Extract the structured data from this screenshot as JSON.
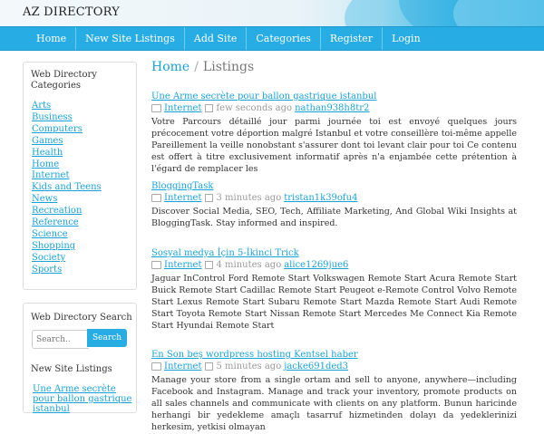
{
  "header": {
    "brand": "AZ DIRECTORY"
  },
  "nav": [
    "Home",
    "New Site Listings",
    "Add Site",
    "Categories",
    "Register",
    "Login"
  ],
  "sidebar": {
    "categories_title": "Web Directory Categories",
    "categories": [
      "Arts",
      "Business",
      "Computers",
      "Games",
      "Health",
      "Home",
      "Internet",
      "Kids and Teens",
      "News",
      "Recreation",
      "Reference",
      "Science",
      "Shopping",
      "Society",
      "Sports"
    ],
    "search_title": "Web Directory Search",
    "search_placeholder": "Search..",
    "search_button": "Search",
    "new_listings_title": "New Site Listings",
    "new_listing_link": "Une Arme secrète pour ballon gastrique istanbul"
  },
  "breadcrumb": {
    "home": "Home",
    "sep": "/",
    "current": "Listings"
  },
  "listings": [
    {
      "title": "Une Arme secrète pour ballon gastrique istanbul",
      "category": "Internet",
      "time": "few seconds ago",
      "user": "nathan938h8tr2",
      "description": "Votre Parcours détaillé jour parmi journée toi est envoyé quelques jours précocement votre déportion malgré Istanbul et votre conseillère toi-même appelle Pareillement la veille nonobstant s'assurer dont toi levant clair pour toi Ce contenu est offert à titre exclusivement informatif après n'a enjambée cette prétention à l'égard de remplacer les"
    },
    {
      "title": "BloggingTask",
      "category": "Internet",
      "time": "3 minutes ago",
      "user": "tristan1k39ofu4",
      "description": "Discover Social Media, SEO, Tech, Affiliate Marketing, And Global Wiki Insights at BloggingTask. Stay informed and inspired."
    },
    {
      "title": "Sosyal medya İçin 5-İkinci Trick",
      "category": "Internet",
      "time": "4 minutes ago",
      "user": "alice1269jue6",
      "description": "Jaguar InControl Ford Remote Start Volkswagen Remote Start Acura Remote Start Buick Remote Start Cadillac Remote Start Peugeot e-Remote Control Volvo Remote Start Lexus Remote Start Subaru Remote Start Mazda Remote Start Audi Remote Start Toyota Remote Start Nissan Remote Start Mercedes Me Connect Kia Remote Start Hyundai Remote Start"
    },
    {
      "title": "En Son beş wordpress hosting Kentsel haber",
      "category": "Internet",
      "time": "5 minutes ago",
      "user": "jacke691ded3",
      "description": "Manage your store from a single ortam and sell to anyone, anywhere—including Facebook and Instagram. Manage and track your inventory, promote products on all sales channels and communicate with clients on any platform. Bunun haricinde herhangi bir yedekleme amaçlı tasarruf hizmetinden dolayı da yedeklerinizi herkesim, yetkisi olmayan"
    }
  ]
}
